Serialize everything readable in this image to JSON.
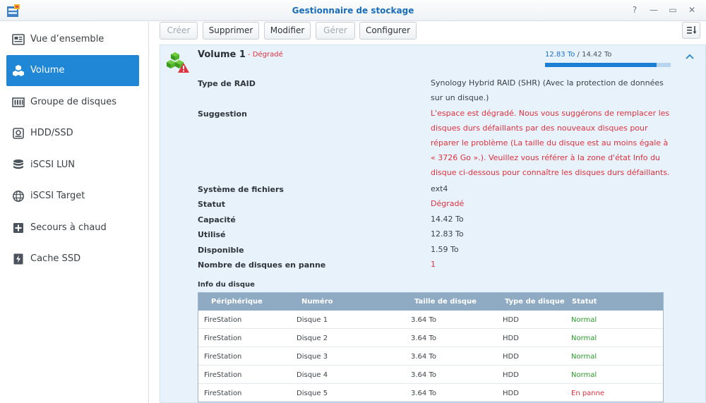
{
  "window": {
    "title": "Gestionnaire de stockage",
    "controls": {
      "help": "?",
      "minimize": "—",
      "maximize": "▭",
      "close": "✕"
    }
  },
  "sidebar": {
    "items": [
      {
        "label": "Vue d’ensemble",
        "icon": "overview-icon",
        "active": false
      },
      {
        "label": "Volume",
        "icon": "volume-cubes-icon",
        "active": true
      },
      {
        "label": "Groupe de disques",
        "icon": "disk-group-icon",
        "active": false
      },
      {
        "label": "HDD/SSD",
        "icon": "hdd-icon",
        "active": false
      },
      {
        "label": "iSCSI LUN",
        "icon": "database-icon",
        "active": false
      },
      {
        "label": "iSCSI Target",
        "icon": "globe-icon",
        "active": false
      },
      {
        "label": "Secours à chaud",
        "icon": "hot-spare-plus-icon",
        "active": false
      },
      {
        "label": "Cache SSD",
        "icon": "ssd-cache-icon",
        "active": false
      }
    ]
  },
  "toolbar": {
    "create": "Créer",
    "delete": "Supprimer",
    "modify": "Modifier",
    "manage": "Gérer",
    "configure": "Configurer"
  },
  "volume": {
    "name": "Volume 1",
    "status_suffix": "- Dégradé",
    "used": "12.83 To",
    "separator": " / ",
    "total": "14.42 To",
    "usage_fraction": 0.89,
    "details": {
      "raid_type_label": "Type de RAID",
      "raid_type_value": "Synology Hybrid RAID (SHR) (Avec la protection de données sur un disque.)",
      "suggestion_label": "Suggestion",
      "suggestion_value": "L'espace est dégradé. Nous vous suggérons de remplacer les disques durs défaillants par des nouveaux disques pour réparer le problème (La taille du disque est au moins égale à « 3726 Go ».). Veuillez vous référer à la zone d'état Info du disque ci-dessous pour connaître les disques durs défaillants.",
      "filesystem_label": "Système de fichiers",
      "filesystem_value": "ext4",
      "status_label": "Statut",
      "status_value": "Dégradé",
      "capacity_label": "Capacité",
      "capacity_value": "14.42 To",
      "used_label": "Utilisé",
      "used_value": "12.83 To",
      "available_label": "Disponible",
      "available_value": "1.59 To",
      "failed_label": "Nombre de disques en panne",
      "failed_value": "1"
    }
  },
  "disk_info": {
    "title": "Info du disque",
    "columns": [
      "Périphérique",
      "Numéro",
      "Taille de disque",
      "Type de disque",
      "Statut"
    ],
    "rows": [
      {
        "device": "FireStation",
        "number": "Disque 1",
        "size": "3.64 To",
        "type": "HDD",
        "status": "Normal"
      },
      {
        "device": "FireStation",
        "number": "Disque 2",
        "size": "3.64 To",
        "type": "HDD",
        "status": "Normal"
      },
      {
        "device": "FireStation",
        "number": "Disque 3",
        "size": "3.64 To",
        "type": "HDD",
        "status": "Normal"
      },
      {
        "device": "FireStation",
        "number": "Disque 4",
        "size": "3.64 To",
        "type": "HDD",
        "status": "Normal"
      },
      {
        "device": "FireStation",
        "number": "Disque 5",
        "size": "3.64 To",
        "type": "HDD",
        "status": "En panne"
      }
    ]
  },
  "colors": {
    "accent": "#1f87d6",
    "degraded": "#e0323e",
    "normal": "#2a9d2a",
    "panel": "#e8f2fb"
  }
}
